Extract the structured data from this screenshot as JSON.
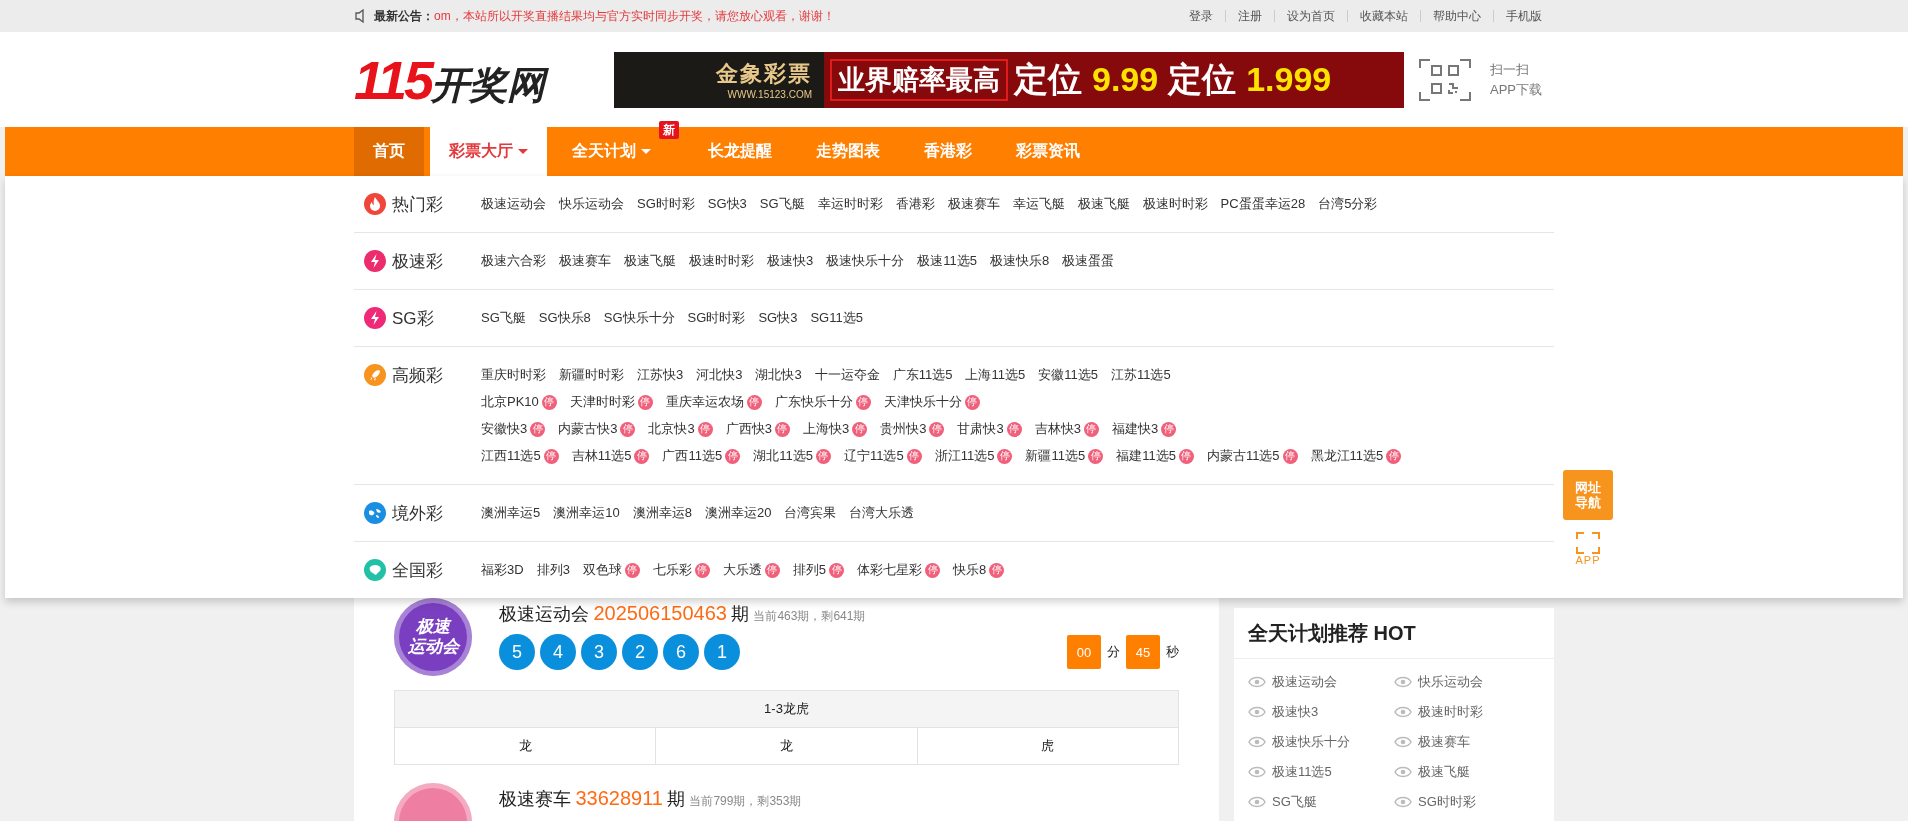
{
  "top_bar": {
    "notice_label": "最新公告：",
    "notice": "om，本站所以开奖直播结果均与官方实时同步开奖，请您放心观看，谢谢！",
    "links": [
      "登录",
      "注册",
      "设为首页",
      "收藏本站",
      "帮助中心",
      "手机版"
    ]
  },
  "header": {
    "logo_number": "115",
    "logo_text": "开奖网",
    "banner": {
      "brand": "金象彩票",
      "url": "WWW.15123.COM",
      "slogan": "业界赔率最高",
      "headline": [
        {
          "text": "定位",
          "kind": "label"
        },
        {
          "text": "9.99",
          "kind": "odds"
        },
        {
          "text": "定位",
          "kind": "label"
        },
        {
          "text": "1.999",
          "kind": "odds"
        }
      ]
    },
    "qr_label": "扫一扫",
    "qr_caption": "APP下载"
  },
  "nav": {
    "items": [
      {
        "label": "首页",
        "selected": true,
        "open": false,
        "caret": false
      },
      {
        "label": "彩票大厅",
        "selected": false,
        "open": true,
        "caret": true
      },
      {
        "label": "全天计划",
        "selected": false,
        "open": false,
        "caret": true,
        "badge": "新"
      },
      {
        "label": "长龙提醒",
        "selected": false,
        "open": false,
        "caret": false
      },
      {
        "label": "走势图表",
        "selected": false,
        "open": false,
        "caret": false
      },
      {
        "label": "香港彩",
        "selected": false,
        "open": false,
        "caret": false
      },
      {
        "label": "彩票资讯",
        "selected": false,
        "open": false,
        "caret": false
      }
    ]
  },
  "menu": {
    "categories": [
      {
        "label": "热门彩",
        "kind": "flame",
        "color": "#f0453a",
        "lines": [
          {
            "items": [
              {
                "label": "极速运动会"
              },
              {
                "label": "快乐运动会"
              },
              {
                "label": "SG时时彩"
              },
              {
                "label": "SG快3"
              },
              {
                "label": "SG飞艇"
              },
              {
                "label": "幸运时时彩"
              },
              {
                "label": "香港彩"
              },
              {
                "label": "极速赛车"
              },
              {
                "label": "幸运飞艇"
              },
              {
                "label": "极速飞艇"
              },
              {
                "label": "极速时时彩"
              },
              {
                "label": "PC蛋蛋幸运28"
              },
              {
                "label": "台湾5分彩"
              }
            ]
          }
        ]
      },
      {
        "label": "极速彩",
        "kind": "bolt",
        "color": "#ec2c6c",
        "lines": [
          {
            "items": [
              {
                "label": "极速六合彩"
              },
              {
                "label": "极速赛车"
              },
              {
                "label": "极速飞艇"
              },
              {
                "label": "极速时时彩"
              },
              {
                "label": "极速快3"
              },
              {
                "label": "极速快乐十分"
              },
              {
                "label": "极速11选5"
              },
              {
                "label": "极速快乐8"
              },
              {
                "label": "极速蛋蛋"
              }
            ]
          }
        ]
      },
      {
        "label": "SG彩",
        "kind": "bolt",
        "color": "#ee2a78",
        "lines": [
          {
            "items": [
              {
                "label": "SG飞艇"
              },
              {
                "label": "SG快乐8"
              },
              {
                "label": "SG快乐十分"
              },
              {
                "label": "SG时时彩"
              },
              {
                "label": "SG快3"
              },
              {
                "label": "SG11选5"
              }
            ]
          }
        ]
      },
      {
        "label": "高频彩",
        "kind": "rocket",
        "color": "#f7931e",
        "lines": [
          {
            "items": [
              {
                "label": "重庆时时彩"
              },
              {
                "label": "新疆时时彩"
              },
              {
                "label": "江苏快3"
              },
              {
                "label": "河北快3"
              },
              {
                "label": "湖北快3"
              },
              {
                "label": "十一运夺金"
              },
              {
                "label": "广东11选5"
              },
              {
                "label": "上海11选5"
              },
              {
                "label": "安徽11选5"
              },
              {
                "label": "江苏11选5"
              }
            ]
          },
          {
            "items": [
              {
                "label": "北京PK10",
                "badge": "停"
              },
              {
                "label": "天津时时彩",
                "badge": "停"
              },
              {
                "label": "重庆幸运农场",
                "badge": "停"
              },
              {
                "label": "广东快乐十分",
                "badge": "停"
              },
              {
                "label": "天津快乐十分",
                "badge": "停"
              }
            ]
          },
          {
            "items": [
              {
                "label": "安徽快3",
                "badge": "停"
              },
              {
                "label": "内蒙古快3",
                "badge": "停"
              },
              {
                "label": "北京快3",
                "badge": "停"
              },
              {
                "label": "广西快3",
                "badge": "停"
              },
              {
                "label": "上海快3",
                "badge": "停"
              },
              {
                "label": "贵州快3",
                "badge": "停"
              },
              {
                "label": "甘肃快3",
                "badge": "停"
              },
              {
                "label": "吉林快3",
                "badge": "停"
              },
              {
                "label": "福建快3",
                "badge": "停"
              }
            ]
          },
          {
            "items": [
              {
                "label": "江西11选5",
                "badge": "停"
              },
              {
                "label": "吉林11选5",
                "badge": "停"
              },
              {
                "label": "广西11选5",
                "badge": "停"
              },
              {
                "label": "湖北11选5",
                "badge": "停"
              },
              {
                "label": "辽宁11选5",
                "badge": "停"
              },
              {
                "label": "浙江11选5",
                "badge": "停"
              },
              {
                "label": "新疆11选5",
                "badge": "停"
              },
              {
                "label": "福建11选5",
                "badge": "停"
              },
              {
                "label": "内蒙古11选5",
                "badge": "停"
              },
              {
                "label": "黑龙江11选5",
                "badge": "停"
              }
            ]
          }
        ]
      },
      {
        "label": "境外彩",
        "kind": "globe",
        "color": "#1a8ee0",
        "lines": [
          {
            "items": [
              {
                "label": "澳洲幸运5"
              },
              {
                "label": "澳洲幸运10"
              },
              {
                "label": "澳洲幸运8"
              },
              {
                "label": "澳洲幸运20"
              },
              {
                "label": "台湾宾果"
              },
              {
                "label": "台湾大乐透"
              }
            ]
          }
        ]
      },
      {
        "label": "全国彩",
        "kind": "map",
        "color": "#22c1a6",
        "lines": [
          {
            "items": [
              {
                "label": "福彩3D"
              },
              {
                "label": "排列3"
              },
              {
                "label": "双色球",
                "badge": "停"
              },
              {
                "label": "七乐彩",
                "badge": "停"
              },
              {
                "label": "大乐透",
                "badge": "停"
              },
              {
                "label": "排列5",
                "badge": "停"
              },
              {
                "label": "体彩七星彩",
                "badge": "停"
              },
              {
                "label": "快乐8",
                "badge": "停"
              }
            ]
          }
        ]
      }
    ]
  },
  "lotteries": [
    {
      "name": "极速运动会",
      "color": "#7a3fc0",
      "logo_text": [
        "极速",
        "运动会"
      ],
      "issue": "202506150463",
      "issue_suffix": "期",
      "note": "当前463期，剩641期",
      "balls": [
        "5",
        "4",
        "3",
        "2",
        "6",
        "1"
      ],
      "countdown": {
        "minutes": "00",
        "minutes_unit": "分",
        "seconds": "45",
        "seconds_unit": "秒"
      },
      "table": {
        "title": "1-3龙虎",
        "cells": [
          "龙",
          "龙",
          "虎"
        ]
      }
    },
    {
      "name": "极速赛车",
      "color": "#ee7fa2",
      "issue": "33628911",
      "issue_suffix": "期",
      "note": "当前799期，剩353期"
    }
  ],
  "sidebar": {
    "title": "全天计划推荐 HOT",
    "items": [
      "极速运动会",
      "快乐运动会",
      "极速快3",
      "极速时时彩",
      "极速快乐十分",
      "极速赛车",
      "极速11选5",
      "极速飞艇",
      "SG飞艇",
      "SG时时彩"
    ]
  },
  "float_nav": {
    "site_nav": [
      "网址",
      "导航"
    ],
    "app_label": "APP"
  }
}
